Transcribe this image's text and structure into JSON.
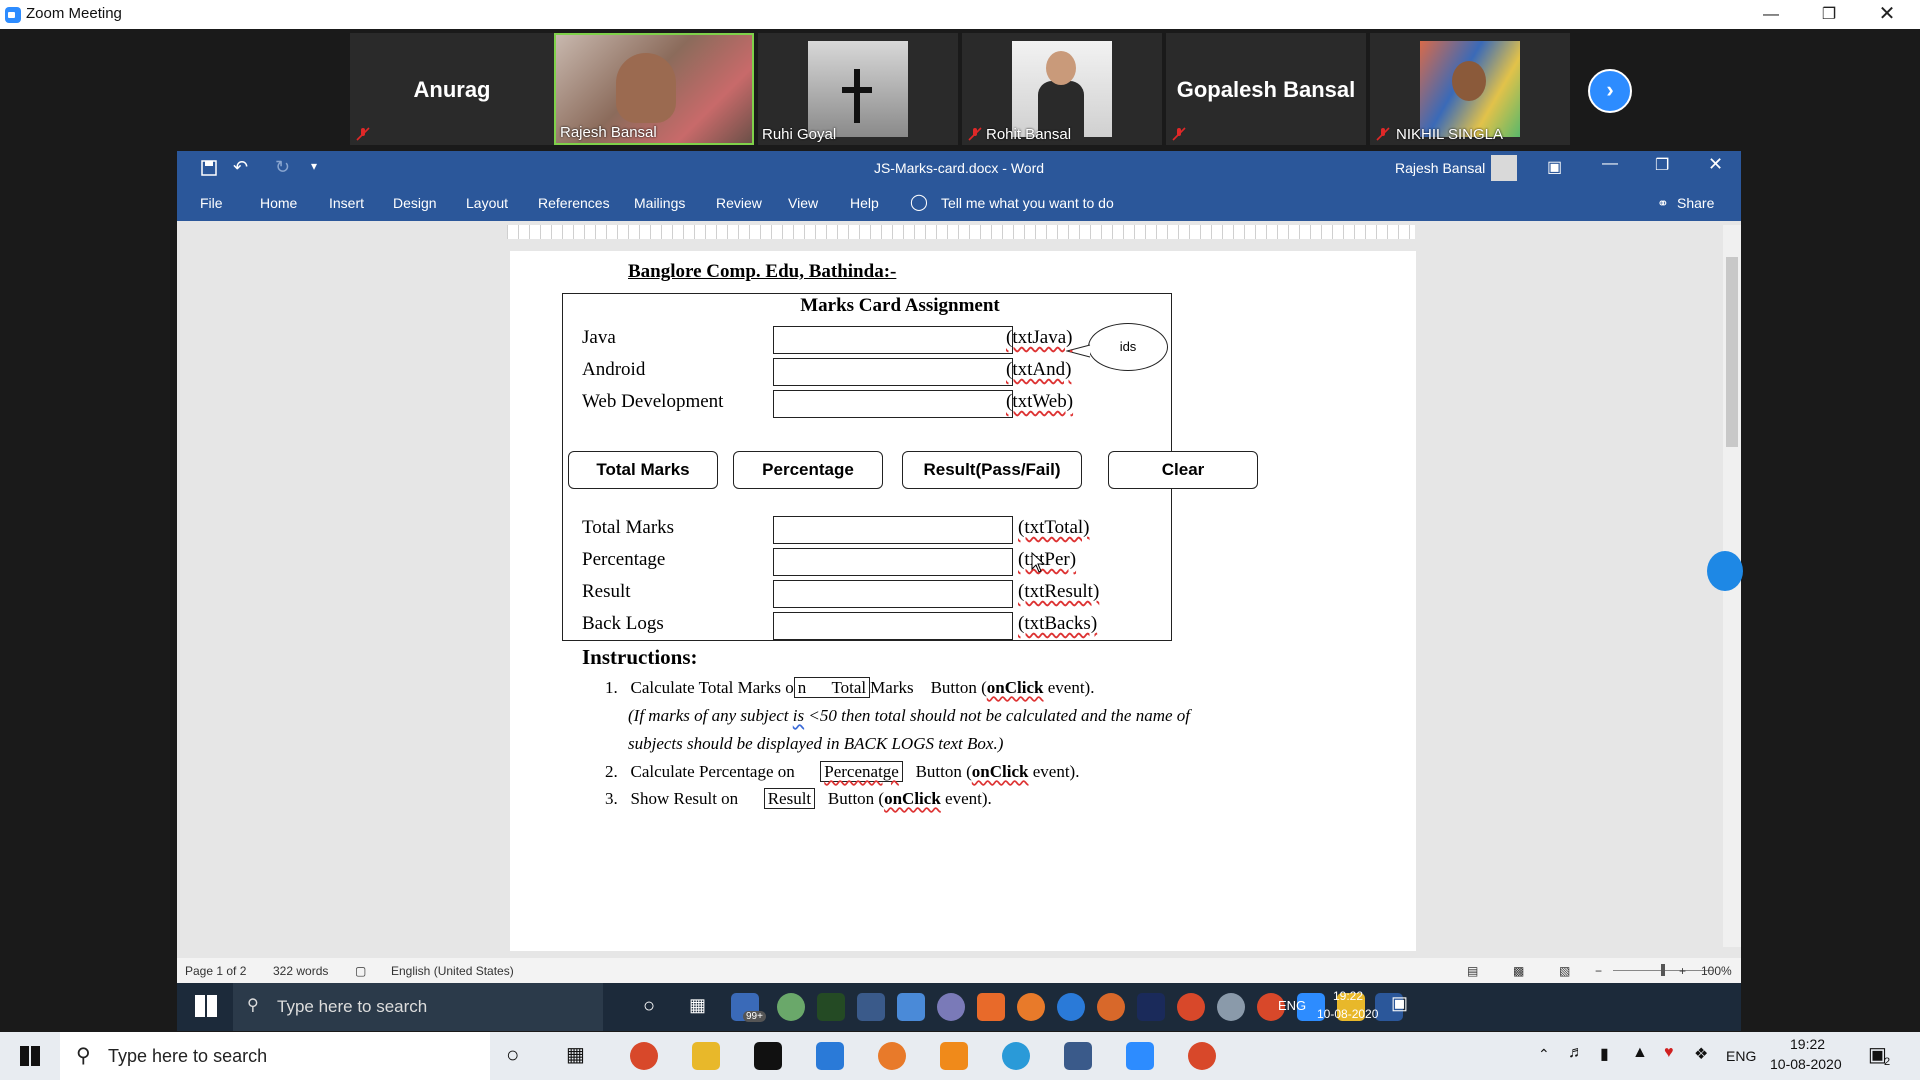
{
  "zoom": {
    "title": "Zoom Meeting",
    "participants": [
      {
        "name": "Anurag",
        "type": "name-only"
      },
      {
        "name": "Rajesh Bansal",
        "type": "video"
      },
      {
        "name": "Ruhi Goyal",
        "type": "video"
      },
      {
        "name": "Rohit Bansal",
        "type": "video"
      },
      {
        "name": "Gopalesh Bansal",
        "type": "name-only"
      },
      {
        "name": "NIKHIL SINGLA",
        "type": "video"
      }
    ],
    "next_icon": "chevron-right-icon"
  },
  "word": {
    "title": "JS-Marks-card.docx  -  Word",
    "user": "Rajesh Bansal",
    "ribbon_tabs": [
      "File",
      "Home",
      "Insert",
      "Design",
      "Layout",
      "References",
      "Mailings",
      "Review",
      "View",
      "Help"
    ],
    "tell_me": "Tell me what you want to do",
    "share": "Share",
    "status": {
      "page": "Page 1 of 2",
      "words": "322 words",
      "language": "English (United States)",
      "zoom": "100%"
    }
  },
  "doc": {
    "heading": "Banglore Comp. Edu, Bathinda:-",
    "form_title": "Marks Card Assignment",
    "callout": "ids",
    "inputs": [
      {
        "label": "Java",
        "id": "(txtJava)"
      },
      {
        "label": "Android",
        "id": "(txtAnd)"
      },
      {
        "label": "Web Development",
        "id": "(txtWeb)"
      }
    ],
    "buttons": [
      "Total Marks",
      "Percentage",
      "Result(Pass/Fail)",
      "Clear"
    ],
    "outputs": [
      {
        "label": "Total Marks",
        "id": "(txtTotal)"
      },
      {
        "label": "Percentage",
        "id": "(txtPer)"
      },
      {
        "label": "Result",
        "id": "(txtResult)"
      },
      {
        "label": "Back Logs",
        "id": "(txtBacks)"
      }
    ],
    "instructions_title": "Instructions:",
    "instructions": {
      "i1_num": "1.",
      "i1_a": "Calculate Total Marks o",
      "i1_box": "n      Total",
      "i1_b": "Marks    Button (",
      "i1_bold": "onClick",
      "i1_c": " event).",
      "i1_note_a": "(If marks of any subject ",
      "i1_note_is": "is",
      "i1_note_b": " <50 then total should not be calculated and the name of",
      "i1_note_c": "subjects should be displayed in BACK LOGS text Box.)",
      "i2_num": "2.",
      "i2_a": "Calculate Percentage on",
      "i2_box": "Percenatge",
      "i2_b": "Button (",
      "i2_bold": "onClick",
      "i2_c": " event).",
      "i3_num": "3.",
      "i3_a": "Show Result on",
      "i3_box": "Result",
      "i3_b": "Button (",
      "i3_bold": "onClick",
      "i3_c": " event)."
    }
  },
  "inner_taskbar": {
    "search": "Type here to search",
    "lang": "ENG",
    "time": "19:22",
    "date": "10-08-2020",
    "badge": "99+"
  },
  "taskbar": {
    "search": "Type here to search",
    "lang": "ENG",
    "time": "19:22",
    "date": "10-08-2020",
    "notifications": "2"
  }
}
